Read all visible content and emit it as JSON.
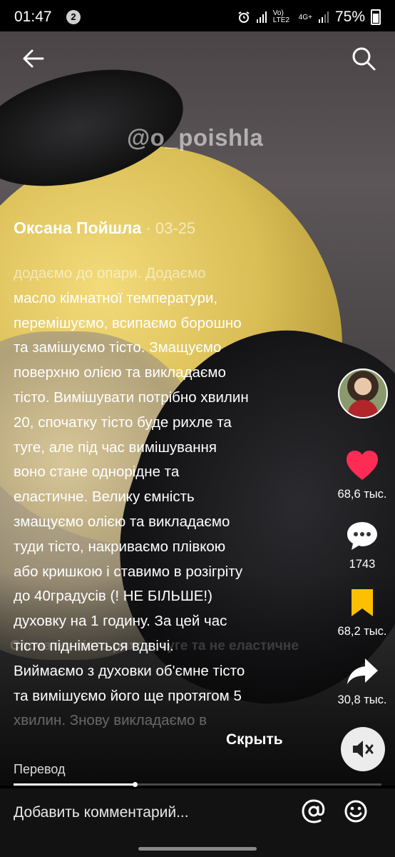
{
  "status_bar": {
    "time": "01:47",
    "notification_count": "2",
    "network": "Vo) LTE2",
    "network_type": "4G+",
    "battery": "75%"
  },
  "video": {
    "watermark": "@o_poishla"
  },
  "post": {
    "author": "Оксана Пойшла",
    "date_prefix": " · ",
    "date": "03-25",
    "description_lines": [
      "додаємо до опари. Додаємо",
      "масло кімнатної температури,",
      "перемішуємо, всипаємо борошно",
      "та замішуємо тісто. Змащуємо",
      "поверхню олією та викладаємо",
      "тісто. Вимішувати потрібно хвилин",
      "20, спочатку тісто буде рихле та",
      "туге, але під час вимішування",
      "воно стане однорідне та",
      "еластичне.  Велику ємність",
      "змащуємо олією та викладаємо",
      "туди тісто, накриваємо плівкою",
      "або кришкою і ставимо в розігріту",
      "до 40градусів (! НЕ БІЛЬШЕ!)",
      "духовку на 1 годину. За цей час",
      "тісто підніметься вдвічі.",
      "Виймаємо з духовки об'ємне тісто",
      "та вимішуємо його ще протягом 5",
      "хвилин.  Знову викладаємо в"
    ],
    "video_caption_ghost": "Спочатку тісто рихле, туге та не еластичне",
    "hide_label": "Скрыть"
  },
  "actions": {
    "likes": "68,6 тыс.",
    "comments": "1743",
    "saves": "68,2 тыс.",
    "shares": "30,8 тыс."
  },
  "footer": {
    "translate_label": "Перевод",
    "progress": 0.33,
    "comment_placeholder": "Добавить комментарий..."
  },
  "colors": {
    "like": "#fe2c55",
    "save": "#fcc000"
  }
}
